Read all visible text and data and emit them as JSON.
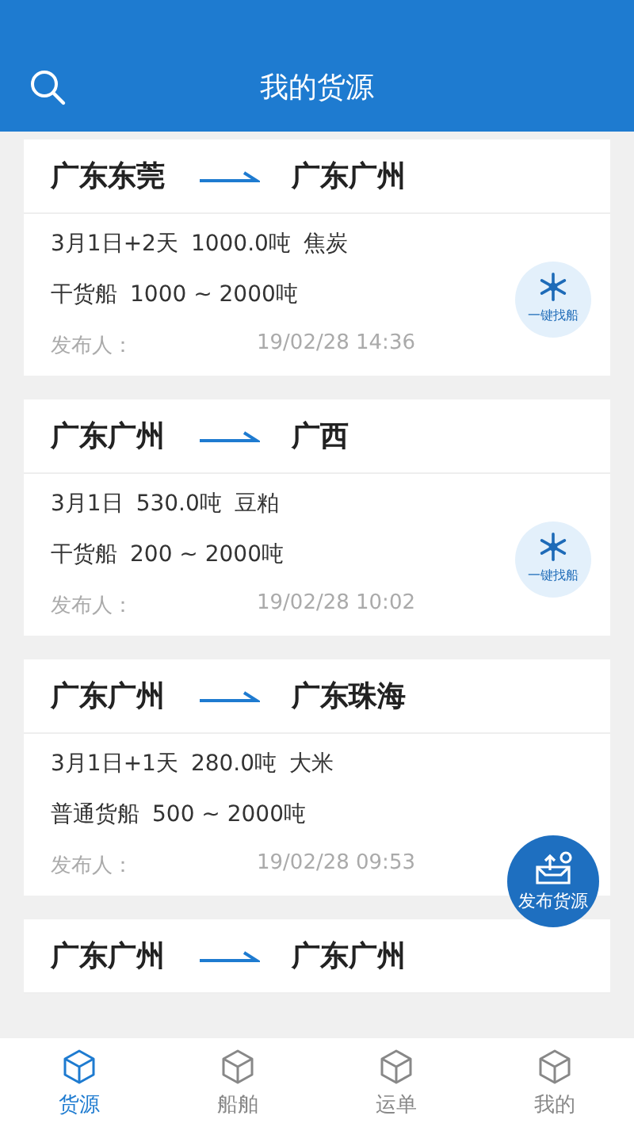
{
  "header": {
    "title": "我的货源"
  },
  "cards": [
    {
      "from": "广东东莞",
      "to": "广东广州",
      "date": "3月1日+2天",
      "weight": "1000.0吨",
      "cargo": "焦炭",
      "ship_type": "干货船",
      "ship_range": "1000 ~ 2000吨",
      "publisher_label": "发布人：",
      "published": "19/02/28 14:36",
      "find_button": "一键找船"
    },
    {
      "from": "广东广州",
      "to": "广西",
      "date": "3月1日",
      "weight": "530.0吨",
      "cargo": "豆粕",
      "ship_type": "干货船",
      "ship_range": "200 ~ 2000吨",
      "publisher_label": "发布人：",
      "published": "19/02/28 10:02",
      "find_button": "一键找船"
    },
    {
      "from": "广东广州",
      "to": "广东珠海",
      "date": "3月1日+1天",
      "weight": "280.0吨",
      "cargo": "大米",
      "ship_type": "普通货船",
      "ship_range": "500 ~ 2000吨",
      "publisher_label": "发布人：",
      "published": "19/02/28 09:53"
    },
    {
      "from": "广东广州",
      "to": "广东广州"
    }
  ],
  "fab": {
    "label": "发布货源"
  },
  "nav": [
    {
      "label": "货源",
      "selected": true
    },
    {
      "label": "船舶",
      "selected": false
    },
    {
      "label": "运单",
      "selected": false
    },
    {
      "label": "我的",
      "selected": false
    }
  ]
}
